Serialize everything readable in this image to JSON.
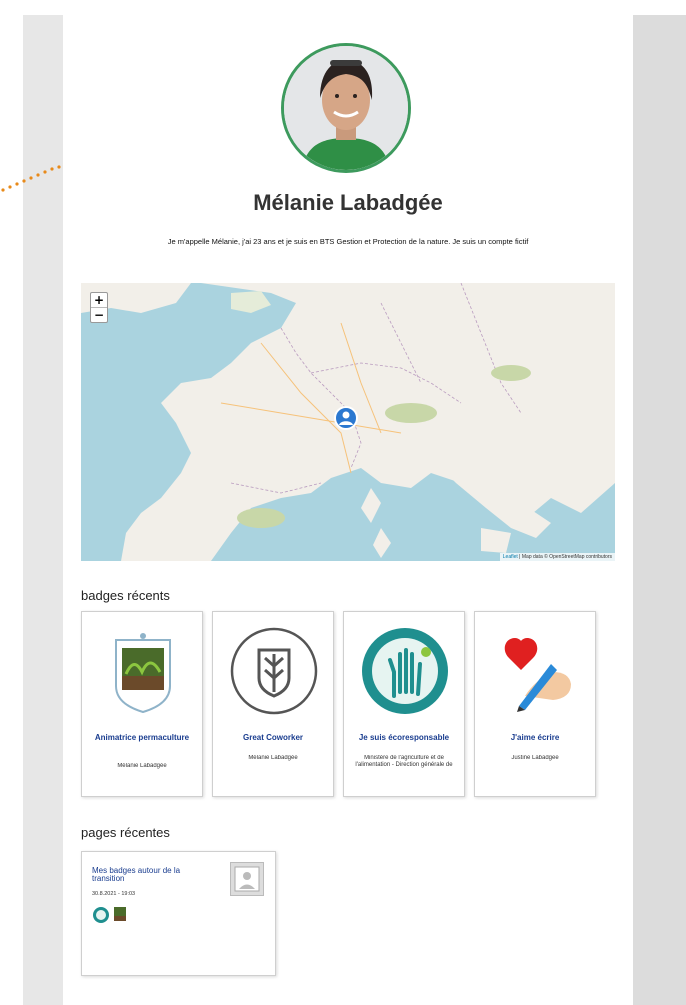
{
  "profile": {
    "name": "Mélanie Labadgée",
    "bio": "Je m'appelle Mélanie, j'ai 23 ans et je suis en BTS Gestion et Protection de la nature. Je suis un compte fictif"
  },
  "map": {
    "zoom_in": "+",
    "zoom_out": "−",
    "attribution_leaflet": "Leaflet",
    "attribution_text": " | Map data © OpenStreetMap contributors"
  },
  "sections": {
    "badges_title": "badges récents",
    "pages_title": "pages récentes"
  },
  "badges": [
    {
      "title": "Animatrice permaculture",
      "owner": "Mélanie Labadgée",
      "icon": "garden-shield-icon"
    },
    {
      "title": "Great Coworker",
      "owner": "Mélanie Labadgée",
      "icon": "leaf-emblem-icon"
    },
    {
      "title": "Je suis écoresponsable",
      "owner": "Ministère de l'agriculture et de l'alimentation - Direction générale de",
      "icon": "eco-hand-icon"
    },
    {
      "title": "J'aime écrire",
      "owner": "Justine Labadgee",
      "icon": "heart-pen-icon"
    }
  ],
  "pages": [
    {
      "title": "Mes badges autour de la transition",
      "meta": "30.8.2021 - 19:03"
    }
  ],
  "colors": {
    "accent_green": "#3d9a5d",
    "link_blue": "#1a3d8f",
    "dots_orange": "#e88a1a"
  }
}
